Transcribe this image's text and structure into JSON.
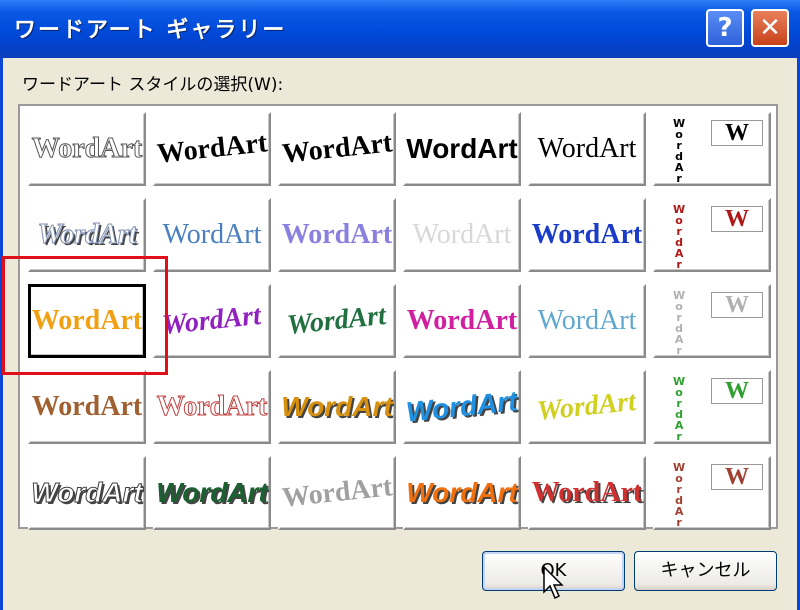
{
  "dialog": {
    "title": "ワードアート ギャラリー",
    "help_label": "?",
    "close_label": "✕"
  },
  "prompt": "ワードアート スタイルの選択(W):",
  "gallery": {
    "sample_text": "WordArt",
    "vertical_text": "WordArt",
    "vertical_box": "W",
    "selected_index": 12,
    "styles": [
      {
        "color": "#ffffff",
        "stroke": "#555555",
        "style": "outline"
      },
      {
        "color": "#000000",
        "style": "arc-bold"
      },
      {
        "color": "#000000",
        "style": "arch"
      },
      {
        "color": "#000000",
        "style": "heavy"
      },
      {
        "color": "#000000",
        "style": "plain-serif"
      },
      {
        "color": "#000000",
        "style": "vertical"
      },
      {
        "color": "#ffffff",
        "stroke": "#8090b0",
        "style": "shadow-italic"
      },
      {
        "color": "#4a7fc0",
        "style": "serif-thin"
      },
      {
        "color": "#8a80e0",
        "style": "lavender"
      },
      {
        "color": "#d8d8d8",
        "style": "silver"
      },
      {
        "color": "#1a3cc8",
        "style": "blue-gradient"
      },
      {
        "color": "#b01818",
        "style": "vertical-red"
      },
      {
        "color": "#f0a010",
        "style": "gold-gradient"
      },
      {
        "color": "#9020c0",
        "style": "purple-wave"
      },
      {
        "color": "#207040",
        "style": "green-wave"
      },
      {
        "color": "#d020a0",
        "style": "rainbow"
      },
      {
        "color": "#60a8d0",
        "style": "teal-serif"
      },
      {
        "color": "#b0b0b0",
        "style": "vertical-gray"
      },
      {
        "color": "#a06030",
        "style": "brown"
      },
      {
        "color": "#ffffff",
        "stroke": "#c04040",
        "style": "red-outline"
      },
      {
        "color": "#d89010",
        "style": "gold-3d"
      },
      {
        "color": "#2090e0",
        "style": "blue-wave-3d"
      },
      {
        "color": "#d0d020",
        "style": "yellow-wave"
      },
      {
        "color": "#30a030",
        "style": "vertical-green"
      },
      {
        "color": "#ffffff",
        "stroke": "#404040",
        "style": "gray-3d"
      },
      {
        "color": "#1a6030",
        "style": "green-3d"
      },
      {
        "color": "#a0a0a0",
        "style": "stone-arch"
      },
      {
        "color": "#f07010",
        "style": "orange-3d"
      },
      {
        "color": "#d03030",
        "style": "red-shadow"
      },
      {
        "color": "#a04030",
        "style": "vertical-brown"
      }
    ]
  },
  "buttons": {
    "ok": "OK",
    "cancel": "キャンセル"
  }
}
